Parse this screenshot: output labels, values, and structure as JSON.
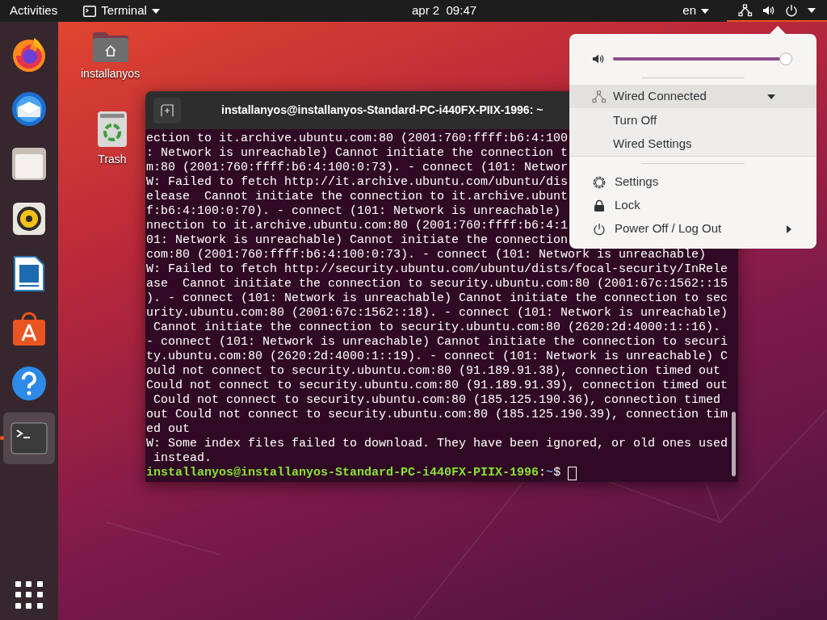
{
  "top_bar": {
    "activities": "Activities",
    "app_menu": "Terminal",
    "clock": "apr 2  09:47",
    "input_source": "en",
    "status_menu_open": true
  },
  "dock": {
    "items": [
      {
        "kind": "firefox",
        "running": false,
        "selected": false
      },
      {
        "kind": "thunderbird",
        "running": false,
        "selected": false
      },
      {
        "kind": "files",
        "running": false,
        "selected": false
      },
      {
        "kind": "rhythmbox",
        "running": false,
        "selected": false
      },
      {
        "kind": "writer",
        "running": false,
        "selected": false
      },
      {
        "kind": "software",
        "running": false,
        "selected": false
      },
      {
        "kind": "help",
        "running": false,
        "selected": false
      },
      {
        "kind": "terminal",
        "running": true,
        "selected": true
      }
    ]
  },
  "desktop_icons": [
    {
      "kind": "home",
      "label": "installanyos"
    },
    {
      "kind": "trash",
      "label": "Trash"
    }
  ],
  "terminal": {
    "title": "installanyos@installanyos-Standard-PC-i440FX-PIIX-1996: ~",
    "lines": [
      "ection to it.archive.ubuntu.com:80 (2001:760:ffff:b6:4:100",
      ": Network is unreachable) Cannot initiate the connection t",
      "m:80 (2001:760:ffff:b6:4:100:0:73). - connect (101: Networ",
      "W: Failed to fetch http://it.archive.ubuntu.com/ubuntu/dis",
      "elease  Cannot initiate the connection to it.archive.ubunt",
      "f:b6:4:100:0:70). - connect (101: Network is unreachable)",
      "nnection to it.archive.ubuntu.com:80 (2001:760:ffff:b6:4:1",
      "01: Network is unreachable) Cannot initiate the connection",
      "com:80 (2001:760:ffff:b6:4:100:0:73). - connect (101: Network is unreachable)",
      "W: Failed to fetch http://security.ubuntu.com/ubuntu/dists/focal-security/InRele",
      "ase  Cannot initiate the connection to security.ubuntu.com:80 (2001:67c:1562::15",
      "). - connect (101: Network is unreachable) Cannot initiate the connection to sec",
      "urity.ubuntu.com:80 (2001:67c:1562::18). - connect (101: Network is unreachable)",
      " Cannot initiate the connection to security.ubuntu.com:80 (2620:2d:4000:1::16).",
      "- connect (101: Network is unreachable) Cannot initiate the connection to securi",
      "ty.ubuntu.com:80 (2620:2d:4000:1::19). - connect (101: Network is unreachable) C",
      "ould not connect to security.ubuntu.com:80 (91.189.91.38), connection timed out",
      "Could not connect to security.ubuntu.com:80 (91.189.91.39), connection timed out",
      " Could not connect to security.ubuntu.com:80 (185.125.190.36), connection timed",
      "out Could not connect to security.ubuntu.com:80 (185.125.190.39), connection tim",
      "ed out",
      "W: Some index files failed to download. They have been ignored, or old ones used",
      " instead."
    ],
    "prompt": {
      "user_host": "installanyos@installanyos-Standard-PC-i440FX-PIIX-1996",
      "separator": ":",
      "path": "~",
      "symbol": "$"
    }
  },
  "system_menu": {
    "volume": {
      "level": 0.98
    },
    "network": {
      "label": "Wired Connected",
      "expanded": true,
      "items": [
        "Turn Off",
        "Wired Settings"
      ]
    },
    "items": [
      {
        "kind": "settings",
        "label": "Settings",
        "submenu": false
      },
      {
        "kind": "lock",
        "label": "Lock",
        "submenu": false
      },
      {
        "kind": "power",
        "label": "Power Off / Log Out",
        "submenu": true
      }
    ]
  }
}
